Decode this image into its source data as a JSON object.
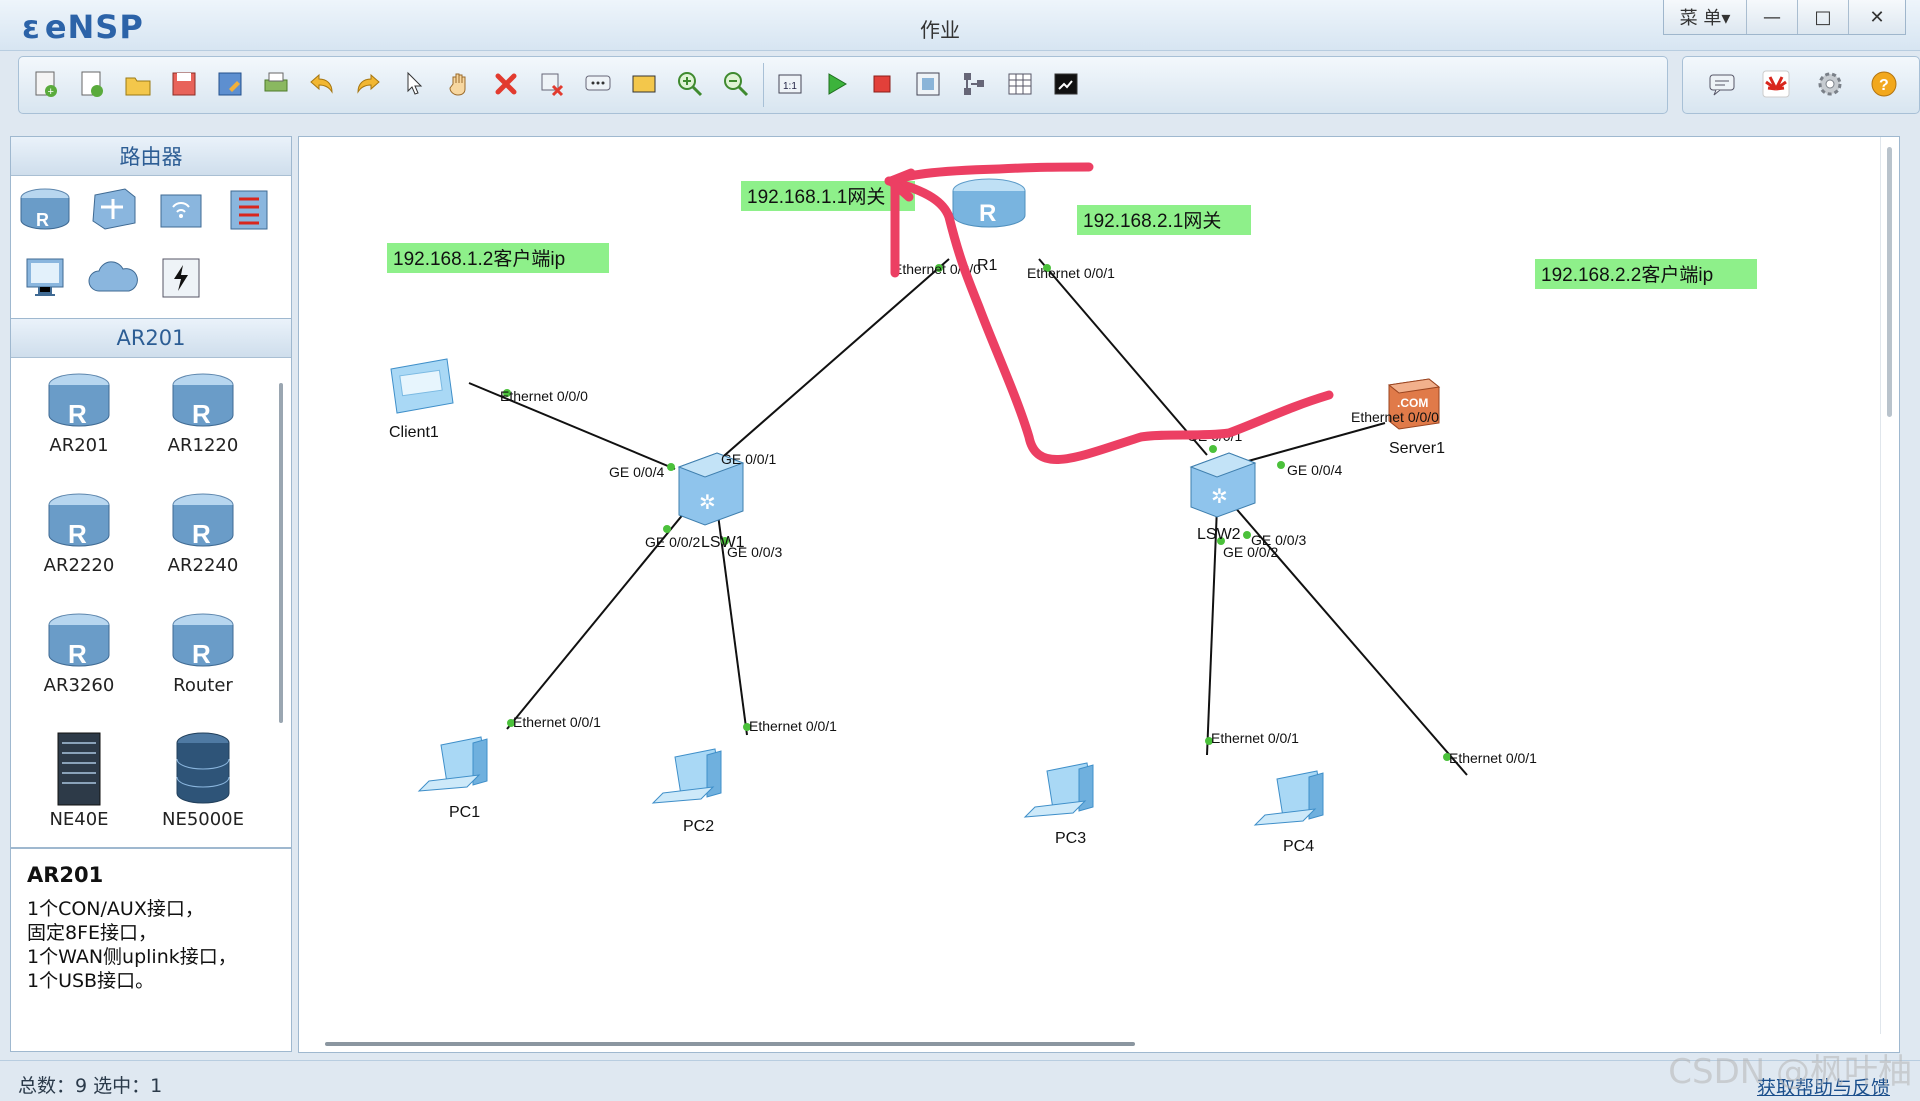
{
  "app": {
    "logo_text": "eNSP",
    "window_title": "作业",
    "menu_label": "菜 单▾"
  },
  "window_controls": [
    "—",
    "□",
    "✕"
  ],
  "toolbar": {
    "icons": [
      "new-topology-icon",
      "new-lab-icon",
      "open-icon",
      "save-icon",
      "save-as-icon",
      "print-icon",
      "undo-icon",
      "redo-icon",
      "select-icon",
      "pan-hand-icon",
      "delete-icon",
      "delete-link-icon",
      "text-note-icon",
      "rectangle-icon",
      "zoom-in-icon",
      "zoom-out-icon",
      "fit-view-icon",
      "start-icon",
      "stop-icon",
      "capture-icon",
      "topology-icon",
      "grid-icon",
      "cli-icon"
    ],
    "right_icons": [
      "message-icon",
      "huawei-icon",
      "settings-icon",
      "help-icon"
    ]
  },
  "sidebar": {
    "category_title": "路由器",
    "category_icons": [
      "router-category-icon",
      "switch-category-icon",
      "wireless-category-icon",
      "firewall-category-icon",
      "pc-category-icon",
      "cloud-category-icon",
      "power-category-icon"
    ],
    "subcategory_title": "AR201",
    "devices": [
      "AR201",
      "AR1220",
      "AR2220",
      "AR2240",
      "AR3260",
      "Router",
      "NE40E",
      "NE5000E"
    ],
    "desc_title": "AR201",
    "desc_text": "1个CON/AUX接口，\n固定8FE接口，\n1个WAN侧uplink接口，\n1个USB接口。"
  },
  "topology": {
    "nodes": {
      "r1": "R1",
      "lsw1": "LSW1",
      "lsw2": "LSW2",
      "client1": "Client1",
      "server1": "Server1",
      "pc1": "PC1",
      "pc2": "PC2",
      "pc3": "PC3",
      "pc4": "PC4"
    },
    "ports": {
      "r1_e0": "Ethernet 0/0/0",
      "r1_e1": "Ethernet 0/0/1",
      "lsw1_ge1": "GE 0/0/1",
      "lsw1_ge4": "GE 0/0/4",
      "lsw1_ge2": "GE 0/0/2",
      "lsw1_ge3": "GE 0/0/3",
      "client_e0": "Ethernet 0/0/0",
      "pc1_e1": "Ethernet 0/0/1",
      "pc2_e1": "Ethernet 0/0/1",
      "lsw2_ge1": "GE 0/0/1",
      "lsw2_ge4": "GE 0/0/4",
      "lsw2_ge2": "GE 0/0/2",
      "lsw2_ge3": "GE 0/0/3",
      "server_e0": "Ethernet 0/0/0",
      "pc3_e1": "Ethernet 0/0/1",
      "pc4_e1": "Ethernet 0/0/1"
    },
    "notes": {
      "gw1": "192.168.1.1网关",
      "gw2": "192.168.2.1网关",
      "client_ip": "192.168.1.2客户端ip",
      "server_ip": "192.168.2.2客户端ip"
    },
    "note_color": "#8ef08a",
    "annotation_color": "#ec3f63"
  },
  "status": {
    "summary": "总数：9 选中：1",
    "help_link": "获取帮助与反馈"
  },
  "watermark": "CSDN @枫叶柚"
}
